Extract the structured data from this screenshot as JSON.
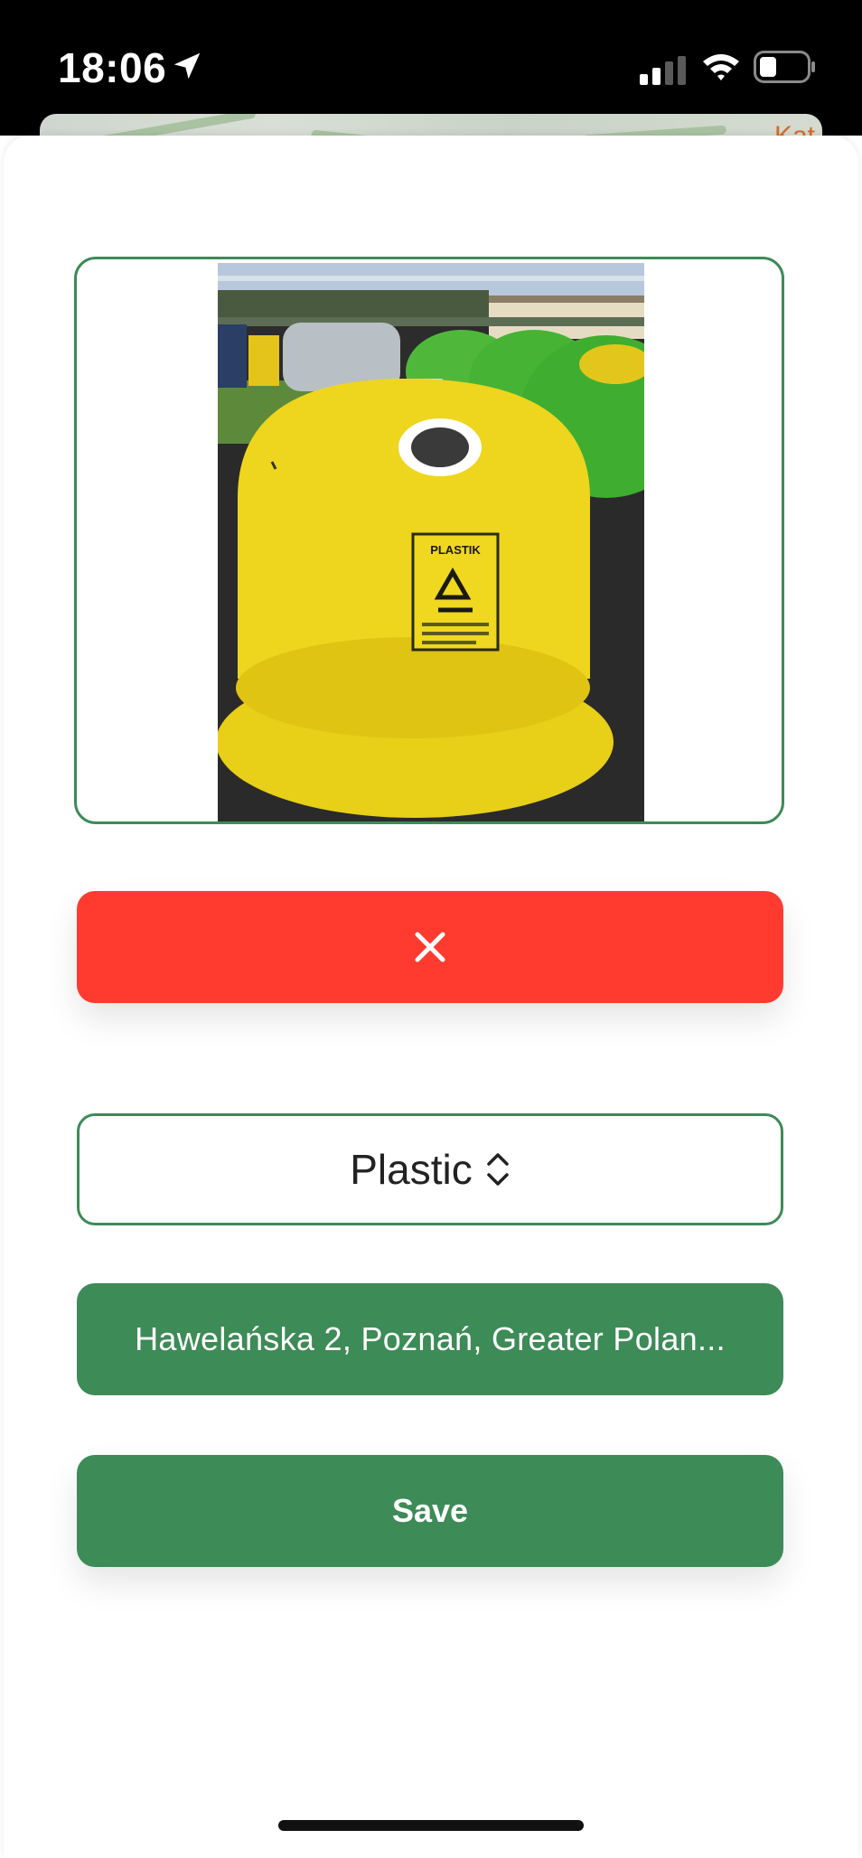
{
  "status_bar": {
    "time": "18:06",
    "location_icon": "location-arrow-icon",
    "signal_icon": "cellular-signal-icon",
    "wifi_icon": "wifi-icon",
    "battery_icon": "battery-icon"
  },
  "map_background": {
    "label": "Kat"
  },
  "photo": {
    "sign_text": "PLASTIK"
  },
  "close_button": {
    "icon": "close-icon",
    "color": "#ff3b30"
  },
  "type_picker": {
    "selected": "Plastic",
    "icon": "chevron-up-down-icon"
  },
  "address_button": {
    "label": "Hawelańska 2, Poznań, Greater Polan..."
  },
  "save_button": {
    "label": "Save"
  },
  "colors": {
    "accent_green": "#3d8b57",
    "danger_red": "#ff3b30"
  }
}
